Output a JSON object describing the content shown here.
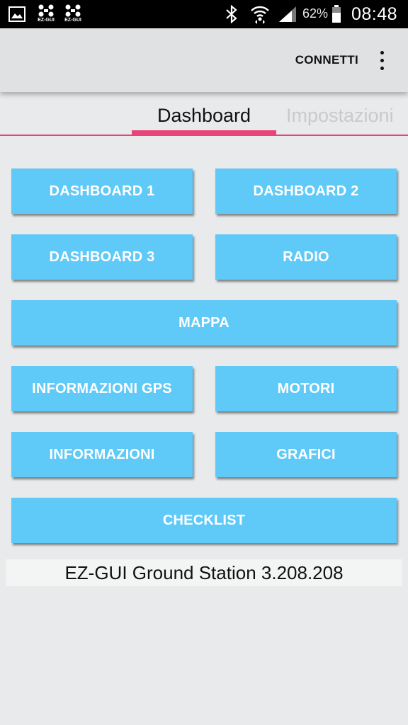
{
  "status_bar": {
    "notification_icons": [
      "picture-icon",
      "ez-gui-icon",
      "ez-gui-icon"
    ],
    "ez_label": "EZ-GUI",
    "battery_percent": "62%",
    "time": "08:48"
  },
  "action_bar": {
    "connect_label": "CONNETTI"
  },
  "tabs": [
    {
      "label": "Dashboard",
      "active": true
    },
    {
      "label": "Impostazioni",
      "active": false
    }
  ],
  "buttons": {
    "dashboard1": "DASHBOARD 1",
    "dashboard2": "DASHBOARD 2",
    "dashboard3": "DASHBOARD 3",
    "radio": "RADIO",
    "mappa": "MAPPA",
    "gps_info": "INFORMAZIONI GPS",
    "motori": "MOTORI",
    "informazioni": "INFORMAZIONI",
    "grafici": "GRAFICI",
    "checklist": "CHECKLIST"
  },
  "version_text": "EZ-GUI Ground Station 3.208.208",
  "colors": {
    "accent": "#e8447a",
    "button": "#5fc9f8",
    "background": "#e8eaeb"
  }
}
